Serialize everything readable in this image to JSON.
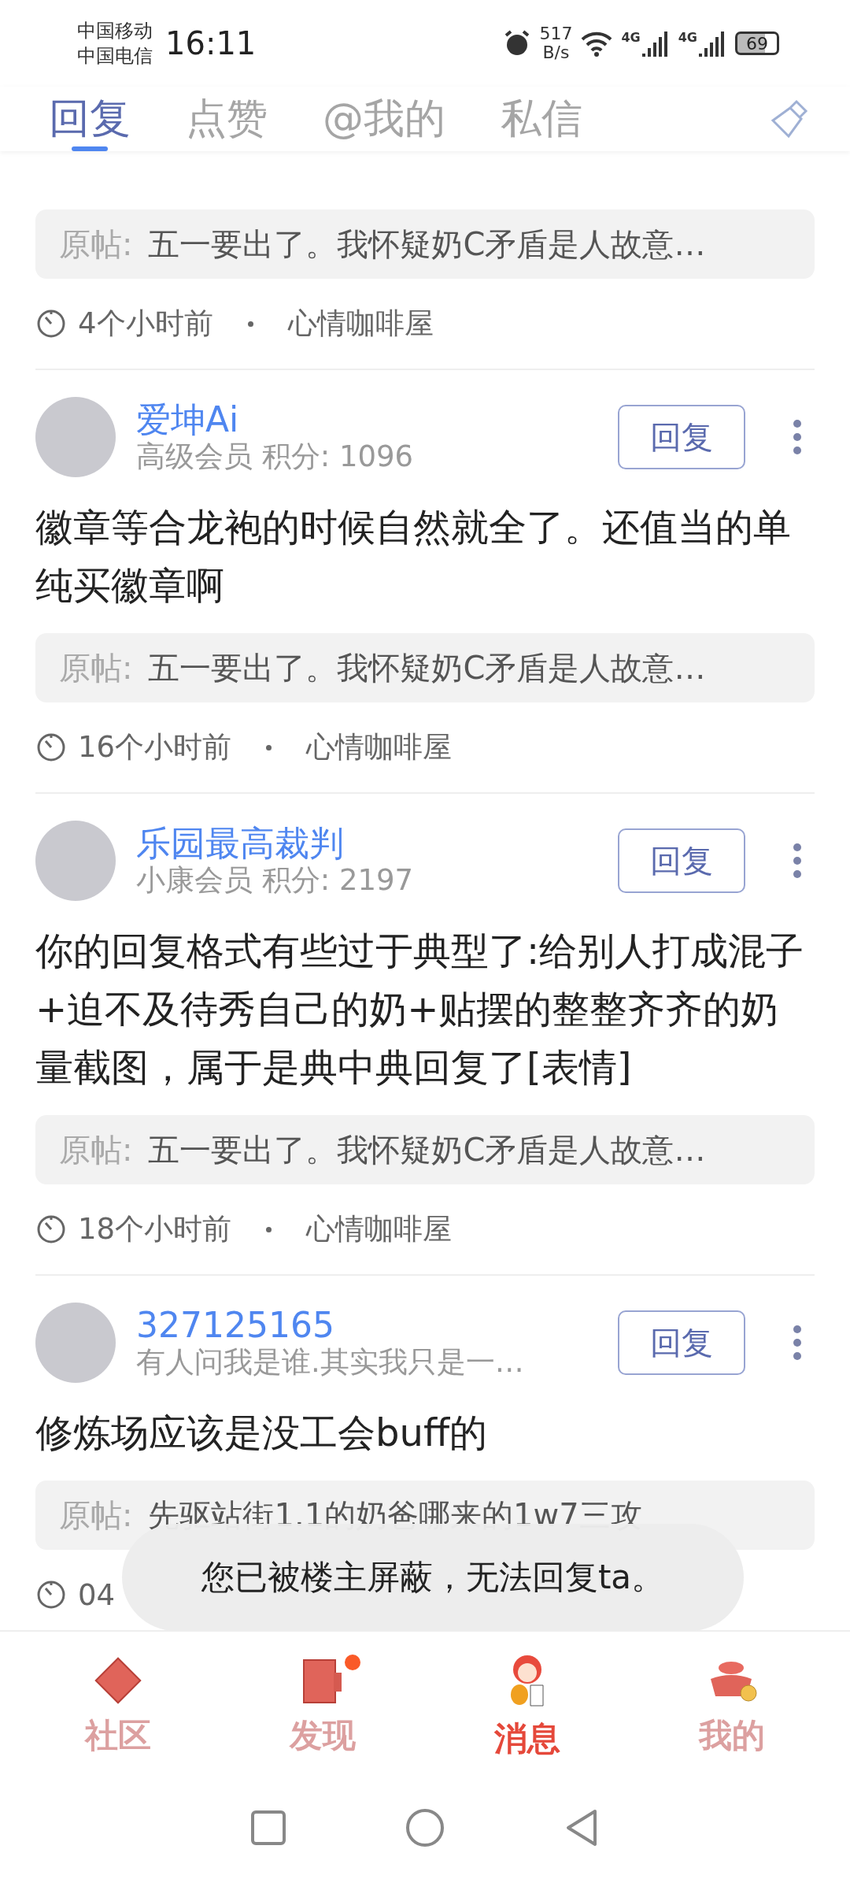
{
  "status_bar": {
    "carriers": [
      "中国移动",
      "中国电信"
    ],
    "time": "16:11",
    "speed_value": "517",
    "speed_unit": "B/s",
    "signals": [
      {
        "label": "4G"
      },
      {
        "label": "4G"
      }
    ],
    "battery": "69"
  },
  "tabs": [
    {
      "label": "回复",
      "selected": true
    },
    {
      "label": "点赞",
      "selected": false
    },
    {
      "label": "@我的",
      "selected": false
    },
    {
      "label": "私信",
      "selected": false
    }
  ],
  "replies": [
    {
      "partial": true,
      "quote_label": "原帖:",
      "quote": "五一要出了。我怀疑奶C矛盾是人故意…",
      "time": "4个小时前",
      "forum": "心情咖啡屋"
    },
    {
      "partial": false,
      "user": "爱坤Ai",
      "subtitle": "高级会员 积分: 1096",
      "reply_button": "回复",
      "content": "徽章等合龙袍的时候自然就全了。还值当的单纯买徽章啊",
      "quote_label": "原帖:",
      "quote": "五一要出了。我怀疑奶C矛盾是人故意…",
      "time": "16个小时前",
      "forum": "心情咖啡屋"
    },
    {
      "partial": false,
      "user": "乐园最高裁判",
      "subtitle": "小康会员 积分: 2197",
      "reply_button": "回复",
      "content": "你的回复格式有些过于典型了:给别人打成混子+迫不及待秀自己的奶+贴摆的整整齐齐的奶量截图，属于是典中典回复了[表情]",
      "quote_label": "原帖:",
      "quote": "五一要出了。我怀疑奶C矛盾是人故意…",
      "time": "18个小时前",
      "forum": "心情咖啡屋"
    },
    {
      "partial": false,
      "user": "327125165",
      "subtitle": "有人问我是谁.其实我只是一…",
      "reply_button": "回复",
      "content": "修炼场应该是没工会buff的",
      "quote_label": "原帖:",
      "quote": "先驱站街1.1的奶爸哪来的1w7三攻",
      "time": "04"
    }
  ],
  "toast": "您已被楼主屏蔽，无法回复ta。",
  "bottom_nav": [
    {
      "label": "社区",
      "selected": false,
      "dot": false
    },
    {
      "label": "发现",
      "selected": false,
      "dot": true
    },
    {
      "label": "消息",
      "selected": true,
      "dot": false
    },
    {
      "label": "我的",
      "selected": false,
      "dot": false
    }
  ]
}
